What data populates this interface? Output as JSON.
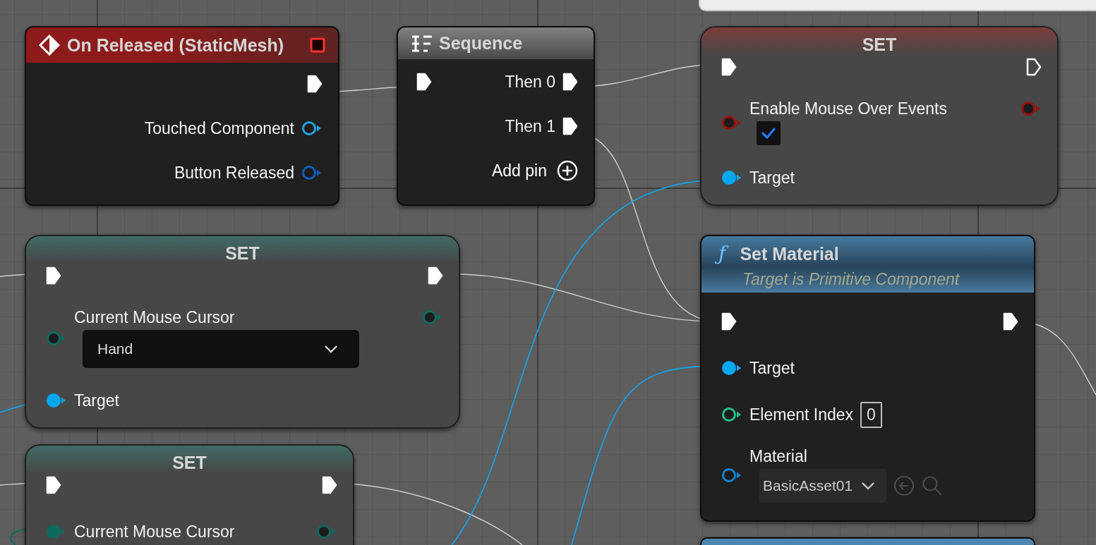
{
  "nodes": [
    {
      "kind": "event",
      "title": "On Released (StaticMesh)",
      "color": "#8e1b1b",
      "rows": [
        {
          "out": {
            "kind": "exec",
            "connected": true
          }
        },
        {
          "label": "Touched Component",
          "out": {
            "kind": "data",
            "connected": false,
            "color": "#1ea4e8"
          }
        },
        {
          "label": "Button Released",
          "out": {
            "kind": "data",
            "connected": false,
            "color": "#0d5cc0"
          }
        }
      ]
    },
    {
      "kind": "sequence",
      "title": "Sequence",
      "color": "#7a7a7a",
      "rows": [
        {
          "in": {
            "kind": "exec",
            "connected": true
          },
          "label": "Then 0",
          "out": {
            "kind": "exec",
            "connected": true
          }
        },
        {
          "label": "Then 1",
          "out": {
            "kind": "exec",
            "connected": true
          }
        },
        {
          "button": "Add pin"
        }
      ]
    },
    {
      "kind": "set",
      "title": "SET",
      "color": "#8a3a3a",
      "rows": [
        {
          "in": {
            "kind": "exec",
            "connected": true
          },
          "out": {
            "kind": "exec",
            "connected": false
          }
        },
        {
          "in": {
            "kind": "data",
            "connected": false,
            "color": "#9a0f0f"
          },
          "label": "Enable Mouse Over Events",
          "widget": {
            "kind": "checkbox",
            "checked": true
          },
          "out": {
            "kind": "data",
            "connected": false,
            "color": "#9a0f0f"
          }
        },
        {
          "in": {
            "kind": "data",
            "connected": true,
            "color": "#00a8f2"
          },
          "label": "Target"
        }
      ]
    },
    {
      "kind": "set",
      "title": "SET",
      "color": "#3e736c",
      "rows": [
        {
          "in": {
            "kind": "exec",
            "connected": true
          },
          "out": {
            "kind": "exec",
            "connected": true
          }
        },
        {
          "in": {
            "kind": "data",
            "connected": false,
            "color": "#0c6a5e"
          },
          "label": "Current Mouse Cursor",
          "widget": {
            "kind": "dropdown",
            "value": "Hand"
          },
          "out": {
            "kind": "data",
            "connected": false,
            "color": "#0c6a5e"
          }
        },
        {
          "in": {
            "kind": "data",
            "connected": true,
            "color": "#00a8f2"
          },
          "label": "Target"
        }
      ]
    },
    {
      "kind": "set",
      "title": "SET",
      "color": "#3e736c",
      "rows": [
        {
          "in": {
            "kind": "exec",
            "connected": true
          },
          "out": {
            "kind": "exec",
            "connected": true
          }
        },
        {
          "in": {
            "kind": "data",
            "connected": true,
            "color": "#0c6a5e"
          },
          "label": "Current Mouse Cursor",
          "out": {
            "kind": "data",
            "connected": false,
            "color": "#0c6a5e"
          }
        }
      ]
    },
    {
      "kind": "function",
      "glyph": "ƒ",
      "title": "Set Material",
      "subtitle": "Target is Primitive Component",
      "color": "#4a82ab",
      "rows": [
        {
          "in": {
            "kind": "exec",
            "connected": true
          },
          "out": {
            "kind": "exec",
            "connected": true
          }
        },
        {
          "in": {
            "kind": "data",
            "connected": true,
            "color": "#00a8f2"
          },
          "label": "Target"
        },
        {
          "in": {
            "kind": "data",
            "connected": false,
            "color": "#1fc08c"
          },
          "label": "Element Index",
          "widget": {
            "kind": "number",
            "value": "0"
          }
        },
        {
          "in": {
            "kind": "data",
            "connected": false,
            "color": "#0a86cf"
          },
          "label": "Material",
          "widget": {
            "kind": "asset_picker",
            "value": "BasicAsset01"
          }
        }
      ]
    },
    {
      "kind": "partial",
      "color": "#4e86b0"
    }
  ]
}
